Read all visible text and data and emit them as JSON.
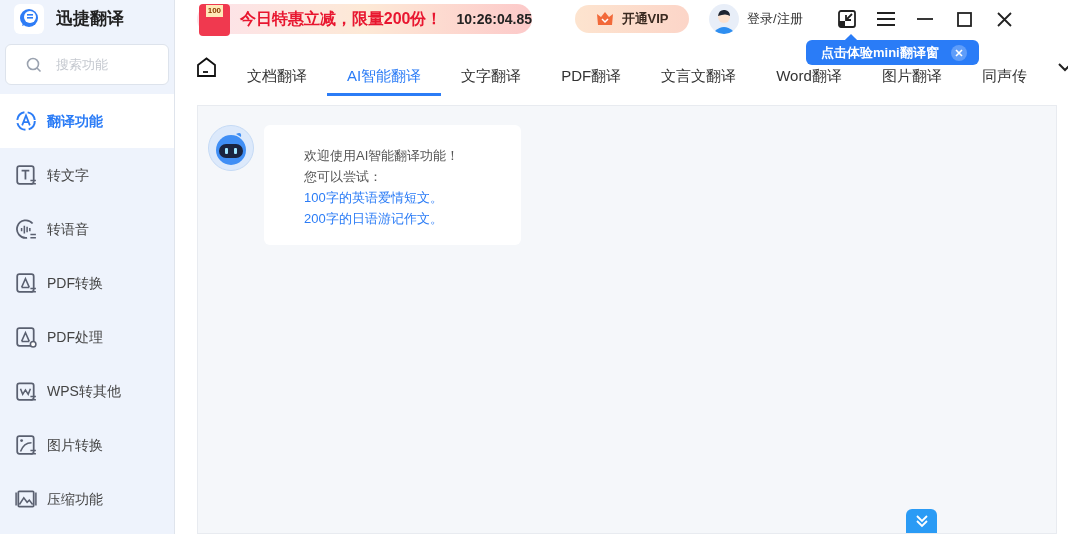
{
  "app": {
    "title": "迅捷翻译"
  },
  "search": {
    "placeholder": "搜索功能"
  },
  "sidebar": {
    "items": [
      {
        "label": "翻译功能",
        "selected": true
      },
      {
        "label": "转文字",
        "selected": false
      },
      {
        "label": "转语音",
        "selected": false
      },
      {
        "label": "PDF转换",
        "selected": false
      },
      {
        "label": "PDF处理",
        "selected": false
      },
      {
        "label": "WPS转其他",
        "selected": false
      },
      {
        "label": "图片转换",
        "selected": false
      },
      {
        "label": "压缩功能",
        "selected": false
      }
    ]
  },
  "promo": {
    "badge": "100",
    "text": "今日特惠立减，限量200份！",
    "countdown": "10:26:04.85"
  },
  "vip_button": {
    "label": "开通VIP"
  },
  "login": {
    "label": "登录/注册"
  },
  "tabs": [
    {
      "label": "文档翻译",
      "selected": false
    },
    {
      "label": "AI智能翻译",
      "selected": true
    },
    {
      "label": "文字翻译",
      "selected": false
    },
    {
      "label": "PDF翻译",
      "selected": false
    },
    {
      "label": "文言文翻译",
      "selected": false
    },
    {
      "label": "Word翻译",
      "selected": false
    },
    {
      "label": "图片翻译",
      "selected": false
    },
    {
      "label": "同声传",
      "selected": false
    }
  ],
  "tooltip": {
    "text": "点击体验mini翻译窗"
  },
  "chat": {
    "greeting": "欢迎使用AI智能翻译功能！",
    "prompt": "您可以尝试：",
    "suggestions": [
      "100字的英语爱情短文。",
      "200字的日语游记作文。"
    ]
  }
}
